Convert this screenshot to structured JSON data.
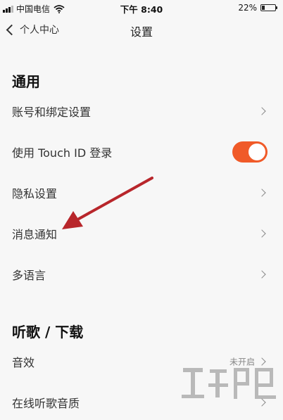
{
  "status_bar": {
    "carrier": "中国电信",
    "time": "下午 8:40",
    "battery_percent": "22%",
    "battery_level": 0.22
  },
  "nav": {
    "back_label": "个人中心",
    "title": "设置"
  },
  "sections": {
    "general": {
      "title": "通用",
      "items": [
        {
          "label": "账号和绑定设置"
        },
        {
          "label": "使用 Touch ID 登录",
          "toggle_on": true
        },
        {
          "label": "隐私设置"
        },
        {
          "label": "消息通知"
        },
        {
          "label": "多语言"
        }
      ]
    },
    "music": {
      "title": "听歌 / 下载",
      "items": [
        {
          "label": "音效",
          "value": "未开启"
        },
        {
          "label": "在线听歌音质"
        }
      ]
    }
  },
  "colors": {
    "accent": "#f05a28",
    "annotation_arrow": "#b8262b"
  }
}
